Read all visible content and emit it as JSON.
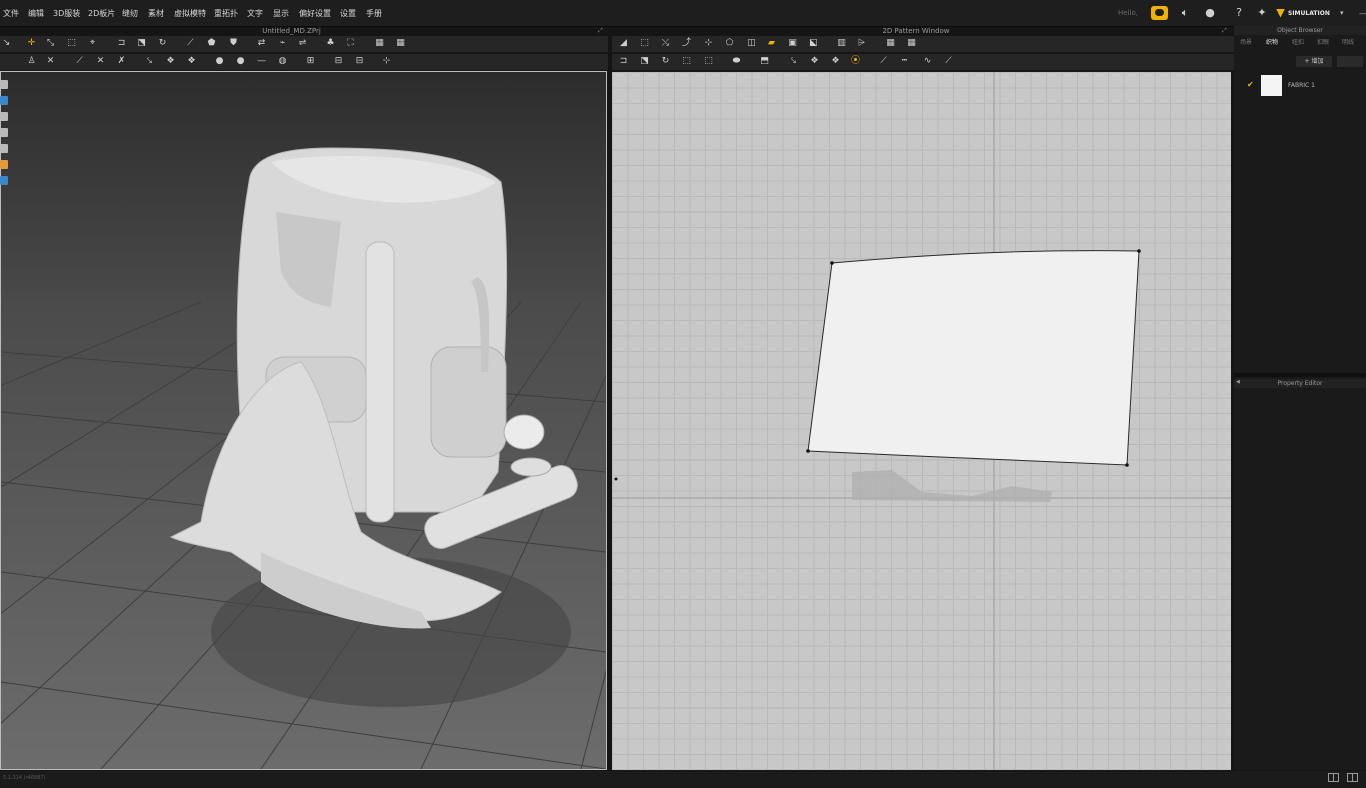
{
  "menu": [
    "文件",
    "编辑",
    "3D服装",
    "2D板片",
    "缝纫",
    "素材",
    "虚拟模特",
    "重拓扑",
    "文字",
    "显示",
    "偏好设置",
    "设置",
    "手册"
  ],
  "greeting": "Hello,",
  "mode_label": "SIMULATION",
  "viewport3d_title": "Untitled_MD.ZPrj",
  "viewport2d_title": "2D Pattern Window",
  "object_browser": {
    "title": "Object Browser",
    "tabs": [
      "场景",
      "织物",
      "纽扣",
      "扣眼",
      "明线"
    ],
    "active_tab": "织物",
    "add_label": "+ 增加",
    "items": [
      {
        "name": "FABRIC 1",
        "checked": true,
        "color": "#f4f4f4"
      }
    ]
  },
  "property_editor_title": "Property Editor",
  "status_text": "5.1.314 (r46887)",
  "icons": {
    "toolbar3d_row1": [
      "select-arrow-icon",
      "move-gizmo-icon",
      "transform-point-icon",
      "box-select-icon",
      "pin-icon",
      "sew-icon",
      "fold-icon",
      "fold-arrange-icon",
      "wrap-icon",
      "tack-icon",
      "garment-icon",
      "move-line-icon",
      "simulation-icon",
      "arrangement-icon",
      "avatar-icon",
      "grid-icon",
      "mesh-icon"
    ],
    "toolbar3d_row2": [
      "walk-icon",
      "steam-icon",
      "cut-icon",
      "zip-icon",
      "segment-sew-icon",
      "free-sew-icon",
      "button-icon",
      "buttonhole-icon",
      "topstitch-icon",
      "pipe-icon",
      "elastic-icon",
      "measure-icon",
      "measure-line-icon",
      "snap-icon"
    ],
    "toolbar2d_row1": [
      "transform-pattern-icon",
      "edit-pattern-icon",
      "edit-curve-icon",
      "curve-point-icon",
      "add-point-icon",
      "polygon-icon",
      "rectangle-icon",
      "circle-icon",
      "internal-polygon-icon",
      "dart-icon",
      "trace-icon",
      "texture-icon",
      "notch-icon",
      "grain-icon",
      "grid-2d-icon"
    ],
    "toolbar2d_row2": [
      "segment-sew-2d-icon",
      "free-sew-2d-icon",
      "check-sew-icon",
      "edit-sew-icon",
      "fold-2d-icon",
      "seam-allowance-icon",
      "pleat-icon",
      "stitch-icon",
      "topstitch-2d-icon",
      "ruler-icon",
      "line-icon",
      "dash-line-icon",
      "zigzag-icon",
      "pen-icon"
    ],
    "side_tools": [
      "shirt-icon",
      "sphere-icon",
      "avatar-icon",
      "cube-icon",
      "flat-icon",
      "face-icon",
      "blue-cube-icon"
    ]
  },
  "colors": {
    "accent": "#f0b400",
    "panel_bg": "#1a1a1a",
    "grid_bg": "#c8c8c8"
  }
}
